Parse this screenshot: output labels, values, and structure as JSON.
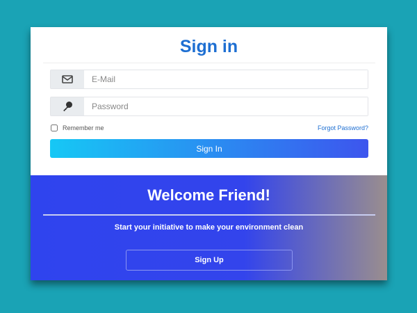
{
  "signin": {
    "title": "Sign in",
    "email_placeholder": "E-Mail",
    "password_placeholder": "Password",
    "remember_label": "Remember me",
    "forgot_link": "Forgot Password?",
    "button_label": "Sign In"
  },
  "welcome": {
    "title": "Welcome Friend!",
    "subtitle": "Start your initiative to make your environment clean",
    "signup_label": "Sign Up"
  },
  "colors": {
    "background": "#1aa3b5",
    "accent": "#1e6fd2",
    "panel": "#2f44ee"
  }
}
